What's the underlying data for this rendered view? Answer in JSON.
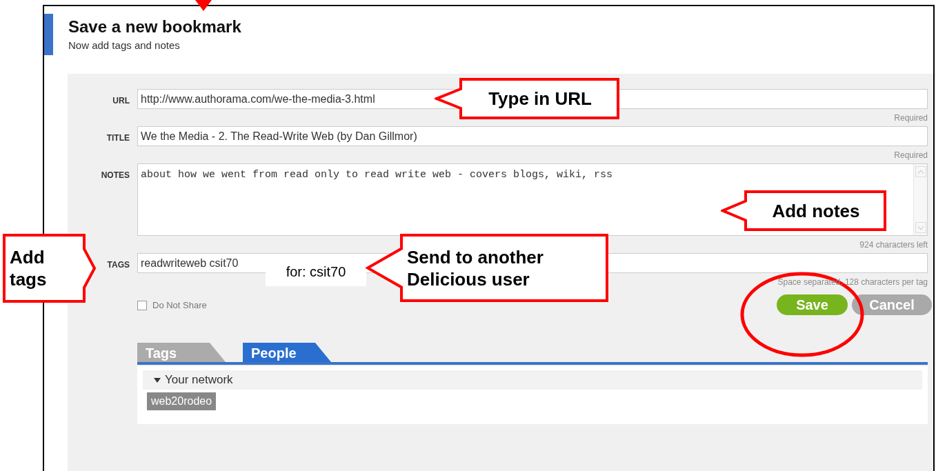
{
  "header": {
    "title": "Save a new bookmark",
    "subtitle": "Now add tags and notes"
  },
  "form": {
    "fields": [
      {
        "label": "URL",
        "kind": "input",
        "value": "http://www.authorama.com/we-the-media-3.html",
        "hint": "Required"
      },
      {
        "label": "TITLE",
        "kind": "input",
        "value": "We the Media - 2. The Read-Write Web (by Dan Gillmor)",
        "hint": "Required"
      },
      {
        "label": "NOTES",
        "kind": "textarea",
        "value": "about how we went from read only to read write web - covers blogs, wiki, rss",
        "hint": "924 characters left"
      },
      {
        "label": "TAGS",
        "kind": "input",
        "value": "readwriteweb csit70",
        "hint": "Space separated, 128 characters per tag"
      }
    ],
    "checkbox": {
      "label": "Do Not Share",
      "checked": false
    },
    "buttons": [
      {
        "label": "Save",
        "kind": "primary"
      },
      {
        "label": "Cancel",
        "kind": "secondary"
      }
    ]
  },
  "panel_tabs": [
    {
      "label": "Tags",
      "selected": false
    },
    {
      "label": "People",
      "selected": true
    }
  ],
  "network": {
    "heading": "Your network",
    "expanded": true,
    "people": [
      "web20rodeo"
    ]
  },
  "annotations": [
    {
      "kind": "arrow"
    },
    {
      "kind": "left-callout",
      "text": "Type in URL"
    },
    {
      "kind": "left-callout",
      "text": "Add notes"
    },
    {
      "kind": "right-callout",
      "text": "Add tags"
    },
    {
      "kind": "note",
      "text": "for: csit70"
    },
    {
      "kind": "left-callout",
      "text": "Send to another Delicious user"
    },
    {
      "kind": "ellipse"
    }
  ]
}
